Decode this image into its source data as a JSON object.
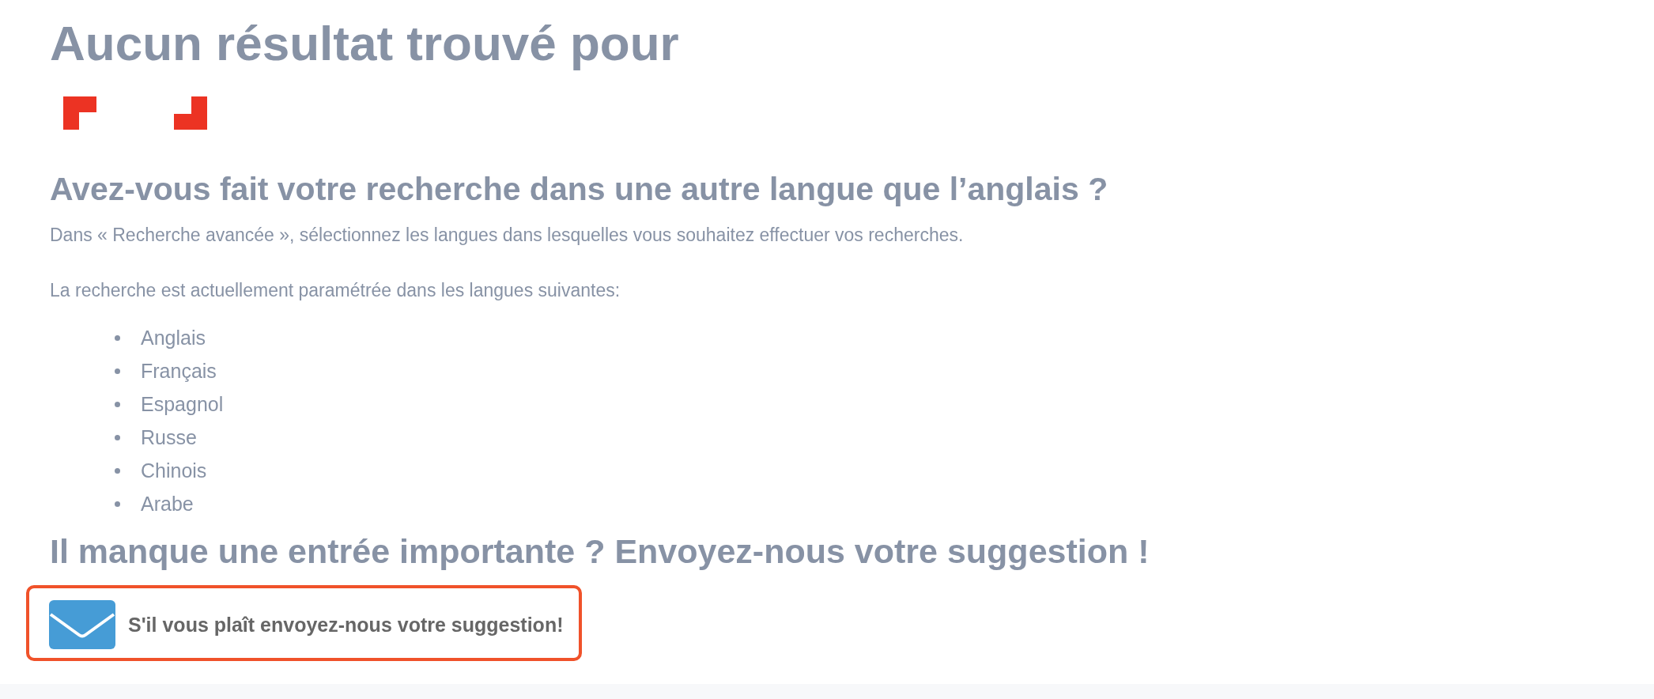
{
  "title": "Aucun résultat trouvé pour",
  "language_section": {
    "heading": "Avez-vous fait votre recherche dans une autre langue que l’anglais ?",
    "paragraphs": [
      "Dans « Recherche avancée », sélectionnez les langues dans lesquelles vous souhaitez effectuer vos recherches.",
      "La recherche est actuellement paramétrée dans les langues suivantes:"
    ],
    "languages": [
      "Anglais",
      "Français",
      "Espagnol",
      "Russe",
      "Chinois",
      "Arabe"
    ]
  },
  "suggestion_section": {
    "heading": "Il manque une entrée importante ? Envoyez-nous votre suggestion !",
    "button": "S'il vous plaît envoyez-nous votre suggestion!"
  }
}
